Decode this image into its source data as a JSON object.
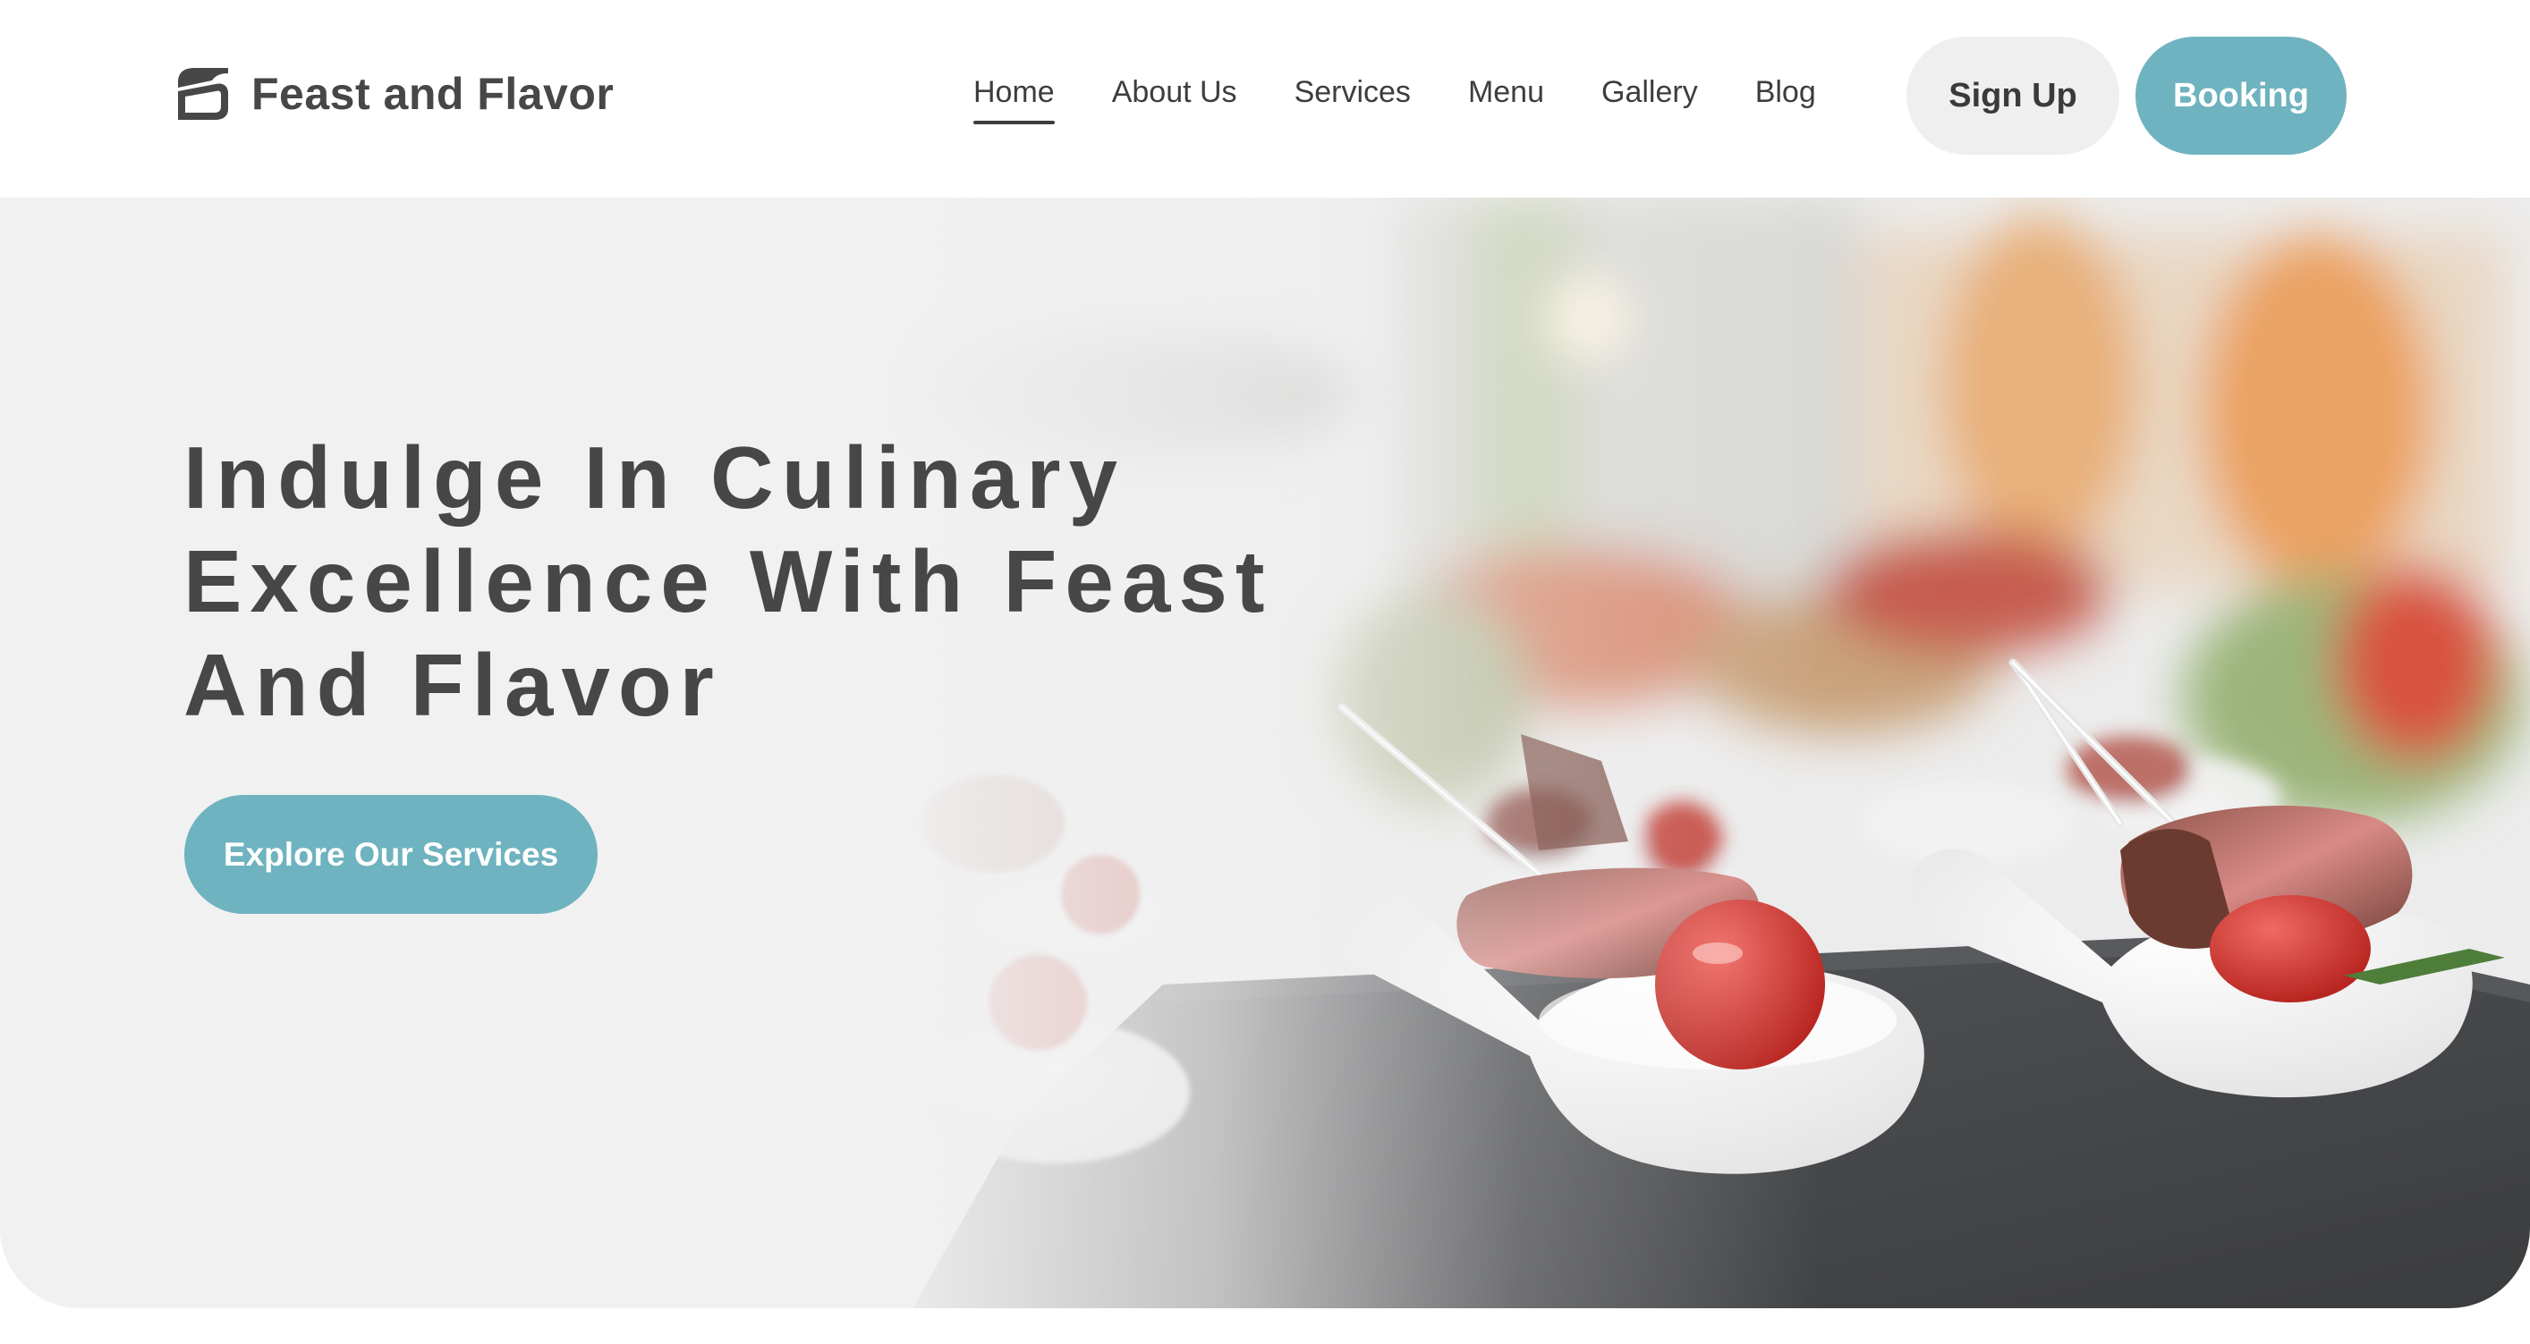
{
  "brand": {
    "name": "Feast and Flavor",
    "logo_icon": "folded-leaf-logo-icon"
  },
  "nav": {
    "items": [
      {
        "label": "Home",
        "active": true
      },
      {
        "label": "About Us",
        "active": false
      },
      {
        "label": "Services",
        "active": false
      },
      {
        "label": "Menu",
        "active": false
      },
      {
        "label": "Gallery",
        "active": false
      },
      {
        "label": "Blog",
        "active": false
      }
    ]
  },
  "header": {
    "signup_label": "Sign Up",
    "booking_label": "Booking"
  },
  "hero": {
    "title": "Indulge In Culinary Excellence With Feast And Flavor",
    "cta_label": "Explore Our Services",
    "image_subject": "plated appetizer spoons with roast beef and cherry tomatoes on slate"
  },
  "colors": {
    "accent": "#6eb3bf",
    "text_dark": "#474747",
    "hero_background": "#f1f1f1",
    "signup_bg": "#efefef"
  }
}
